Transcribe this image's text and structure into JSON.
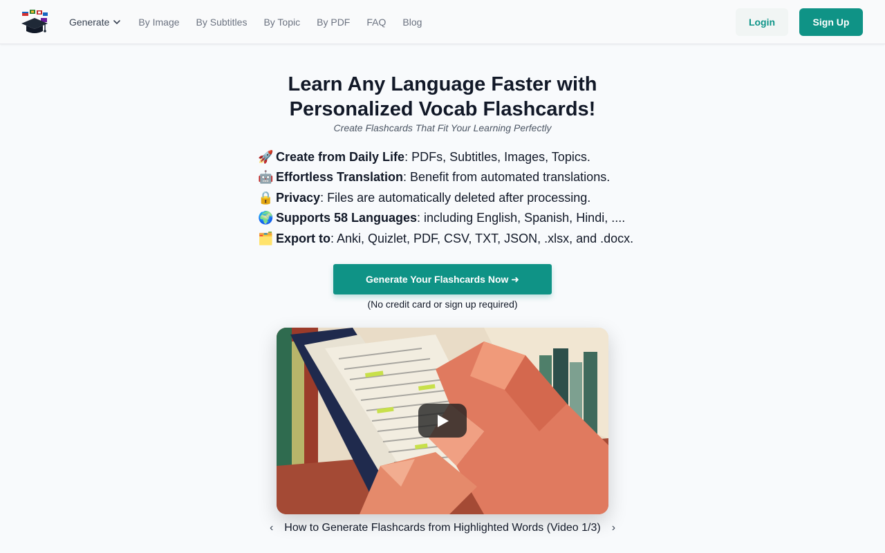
{
  "header": {
    "nav": {
      "generate": "Generate",
      "by_image": "By Image",
      "by_subtitles": "By Subtitles",
      "by_topic": "By Topic",
      "by_pdf": "By PDF",
      "faq": "FAQ",
      "blog": "Blog"
    },
    "login": "Login",
    "signup": "Sign Up"
  },
  "hero": {
    "title_line1": "Learn Any Language Faster with",
    "title_line2": "Personalized Vocab Flashcards!",
    "subtitle": "Create Flashcards That Fit Your Learning Perfectly",
    "features": [
      {
        "emoji": "🚀",
        "bold": "Create from Daily Life",
        "text": ": PDFs, Subtitles, Images, Topics."
      },
      {
        "emoji": "🤖",
        "bold": "Effortless Translation",
        "text": ": Benefit from automated translations."
      },
      {
        "emoji": "🔒",
        "bold": "Privacy",
        "text": ": Files are automatically deleted after processing."
      },
      {
        "emoji": "🌍",
        "bold": "Supports 58 Languages",
        "text": ": including English, Spanish, Hindi, ...."
      },
      {
        "emoji": "🗂️",
        "bold": "Export to",
        "text": ": Anki, Quizlet, PDF, CSV, TXT, JSON, .xlsx, and .docx."
      }
    ],
    "cta": "Generate Your Flashcards Now ➜",
    "cta_note": "(No credit card or sign up required)"
  },
  "video": {
    "prev": "‹",
    "next": "›",
    "caption": "How to Generate Flashcards from Highlighted Words (Video 1/3)"
  },
  "icons": {
    "logo": "graduation-cap-flags-logo",
    "chevron": "chevron-down-icon",
    "play": "play-icon"
  },
  "colors": {
    "accent": "#0f9386",
    "background": "#f8fafc"
  }
}
